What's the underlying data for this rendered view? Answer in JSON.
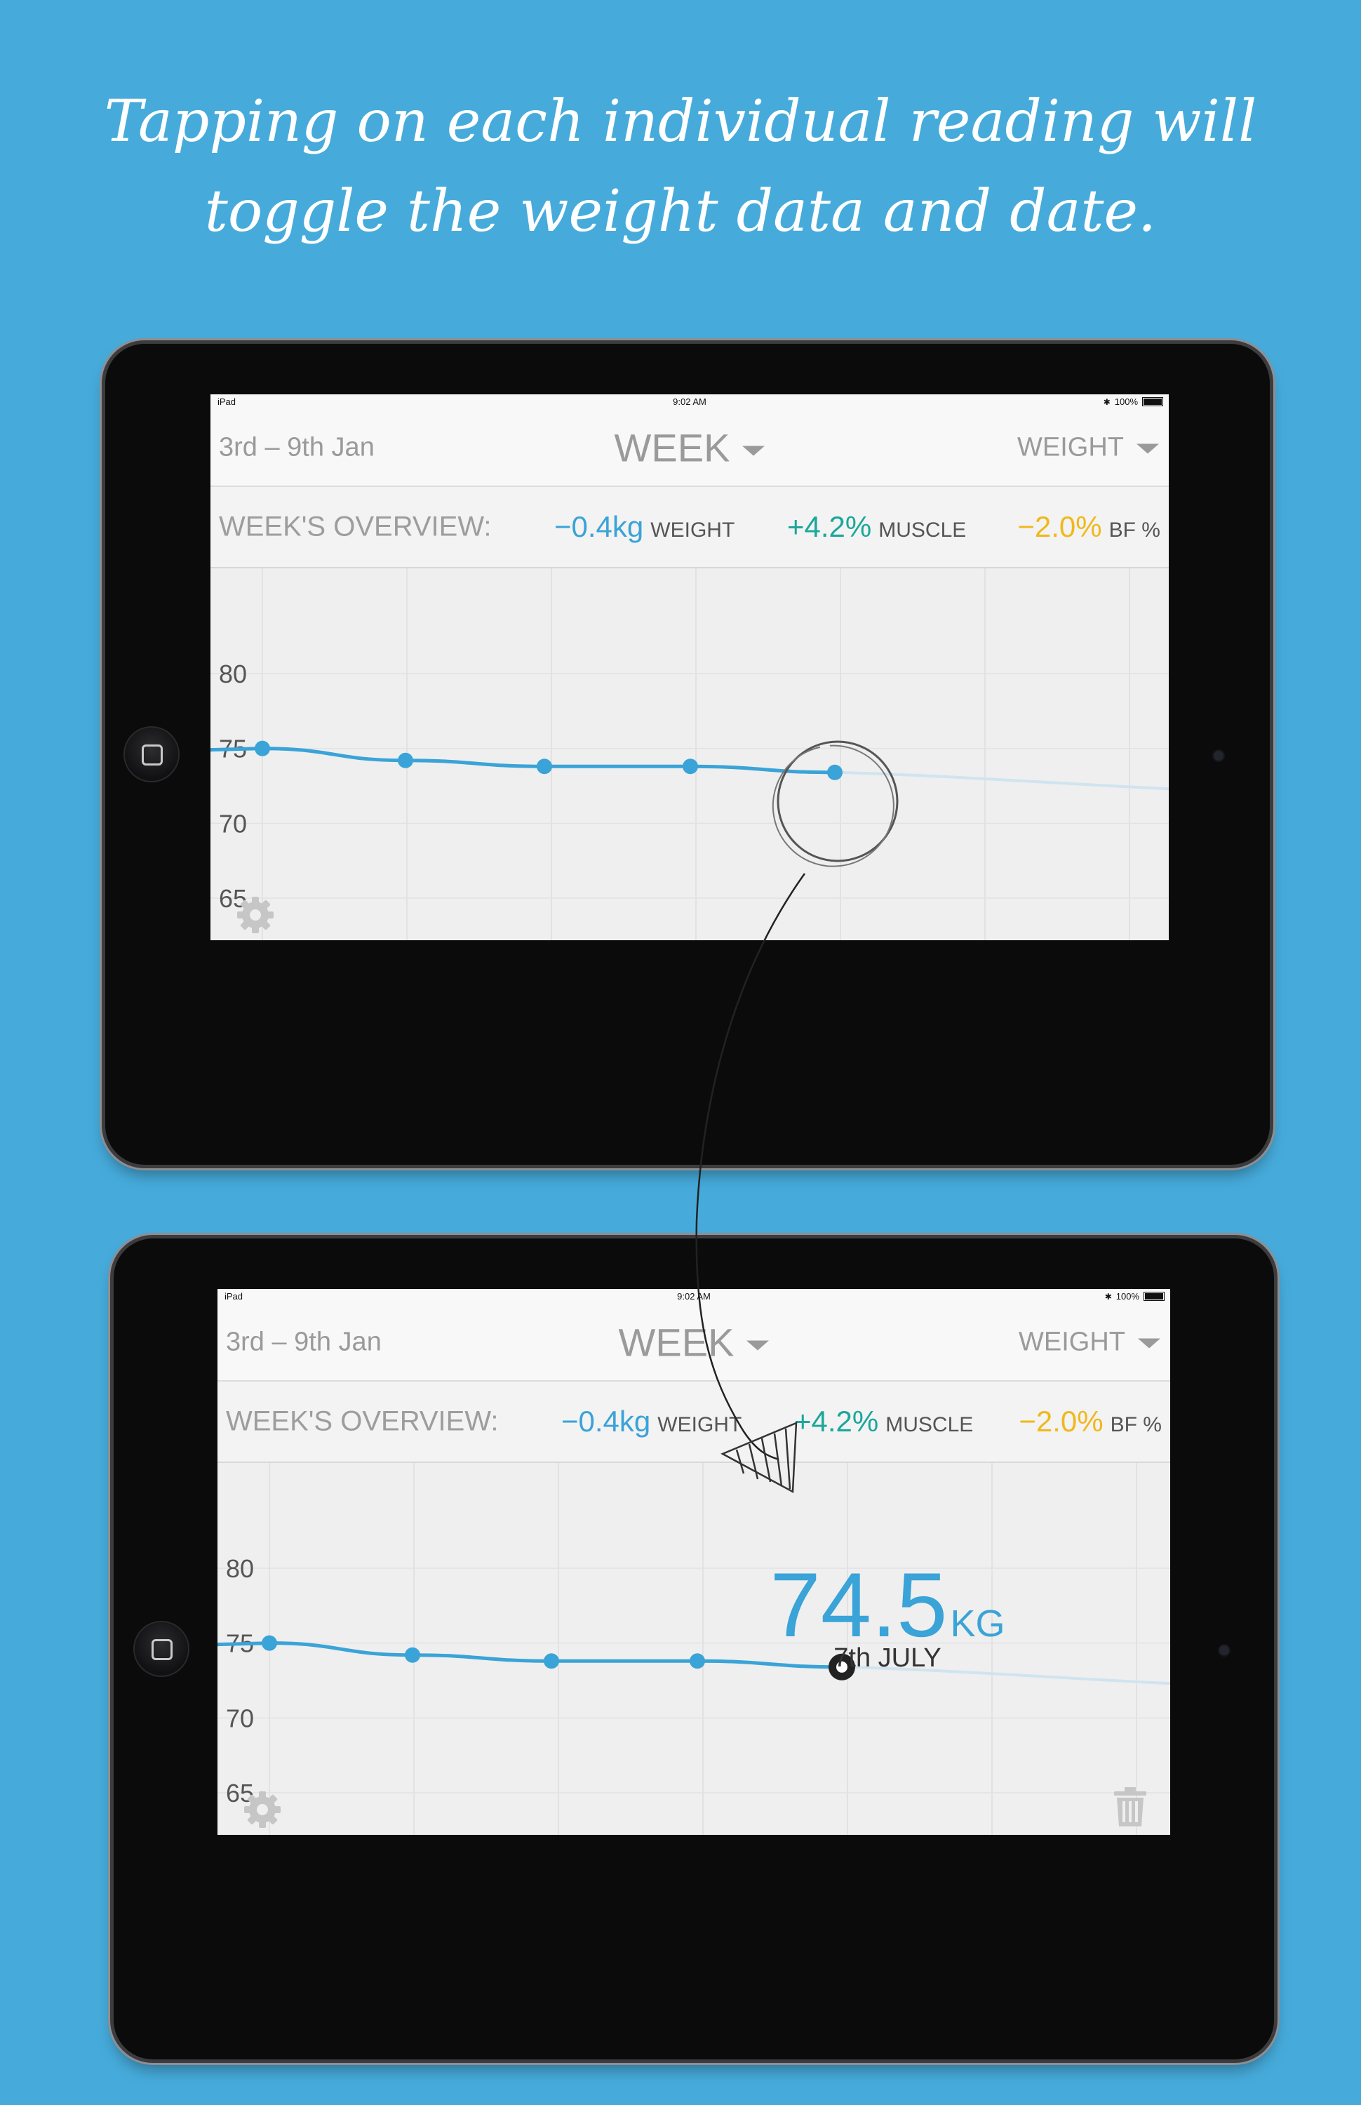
{
  "headline": {
    "line1": "Tapping on each individual reading will",
    "line2": "toggle the weight data and date."
  },
  "status_bar": {
    "device": "iPad",
    "time": "9:02 AM",
    "battery": "100%"
  },
  "header": {
    "date_range": "3rd – 9th Jan",
    "period": "WEEK",
    "metric": "WEIGHT"
  },
  "overview": {
    "label": "WEEK'S OVERVIEW:",
    "weight": {
      "value": "−0.4kg",
      "name": "WEIGHT"
    },
    "muscle": {
      "value": "+4.2%",
      "name": "MUSCLE"
    },
    "bodyfat": {
      "value": "−2.0%",
      "name": "BF %"
    }
  },
  "chart": {
    "y_ticks": [
      "80",
      "75",
      "70",
      "65"
    ],
    "readings": [
      75.0,
      74.2,
      73.8,
      73.8,
      73.4
    ],
    "projection": 72.3
  },
  "selected_reading": {
    "value": "74.5",
    "unit": "KG",
    "date": "7th JULY"
  },
  "colors": {
    "background": "#46abdb",
    "weight": "#3aa3d7",
    "muscle": "#1ba79a",
    "bodyfat": "#f0b81b",
    "line": "#3aa3d7"
  }
}
